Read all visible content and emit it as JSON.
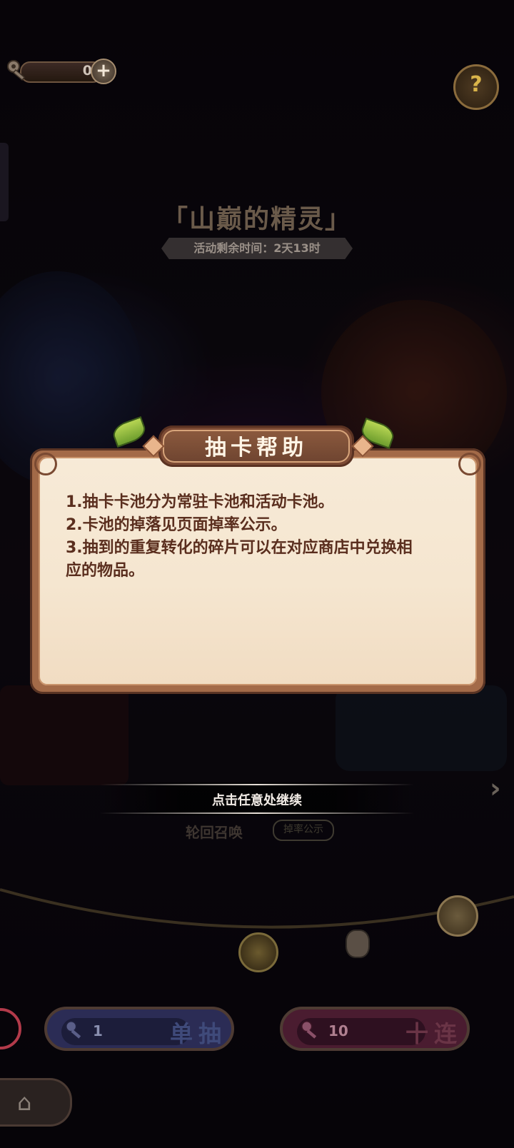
{
  "currency": {
    "value": "0",
    "add_symbol": "+"
  },
  "help_icon_symbol": "?",
  "event": {
    "title": "「山巅的精灵」",
    "remaining": "活动剩余时间：2天13时"
  },
  "dialog": {
    "title": "抽卡帮助",
    "lines": [
      "1.抽卡卡池分为常驻卡池和活动卡池。",
      "2.卡池的掉落见页面掉率公示。",
      "3.抽到的重复转化的碎片可以在对应商店中兑换相",
      "应的物品。"
    ]
  },
  "continue_hint": "点击任意处继续",
  "behind_overlay": {
    "pool_name": "轮回召唤",
    "rate_label": "掉率公示"
  },
  "pulls": {
    "single": {
      "count": "1",
      "label": "单抽"
    },
    "ten": {
      "count": "10",
      "label": "十连"
    }
  },
  "nav": {
    "next_arrow": "›",
    "home_icon": "home-icon"
  },
  "colors": {
    "dialog_text": "#5a2e1e",
    "parchment": "#f7ead7",
    "frame": "#a36a48",
    "single_btn": "#2b2c55",
    "ten_btn": "#4a1c30"
  }
}
